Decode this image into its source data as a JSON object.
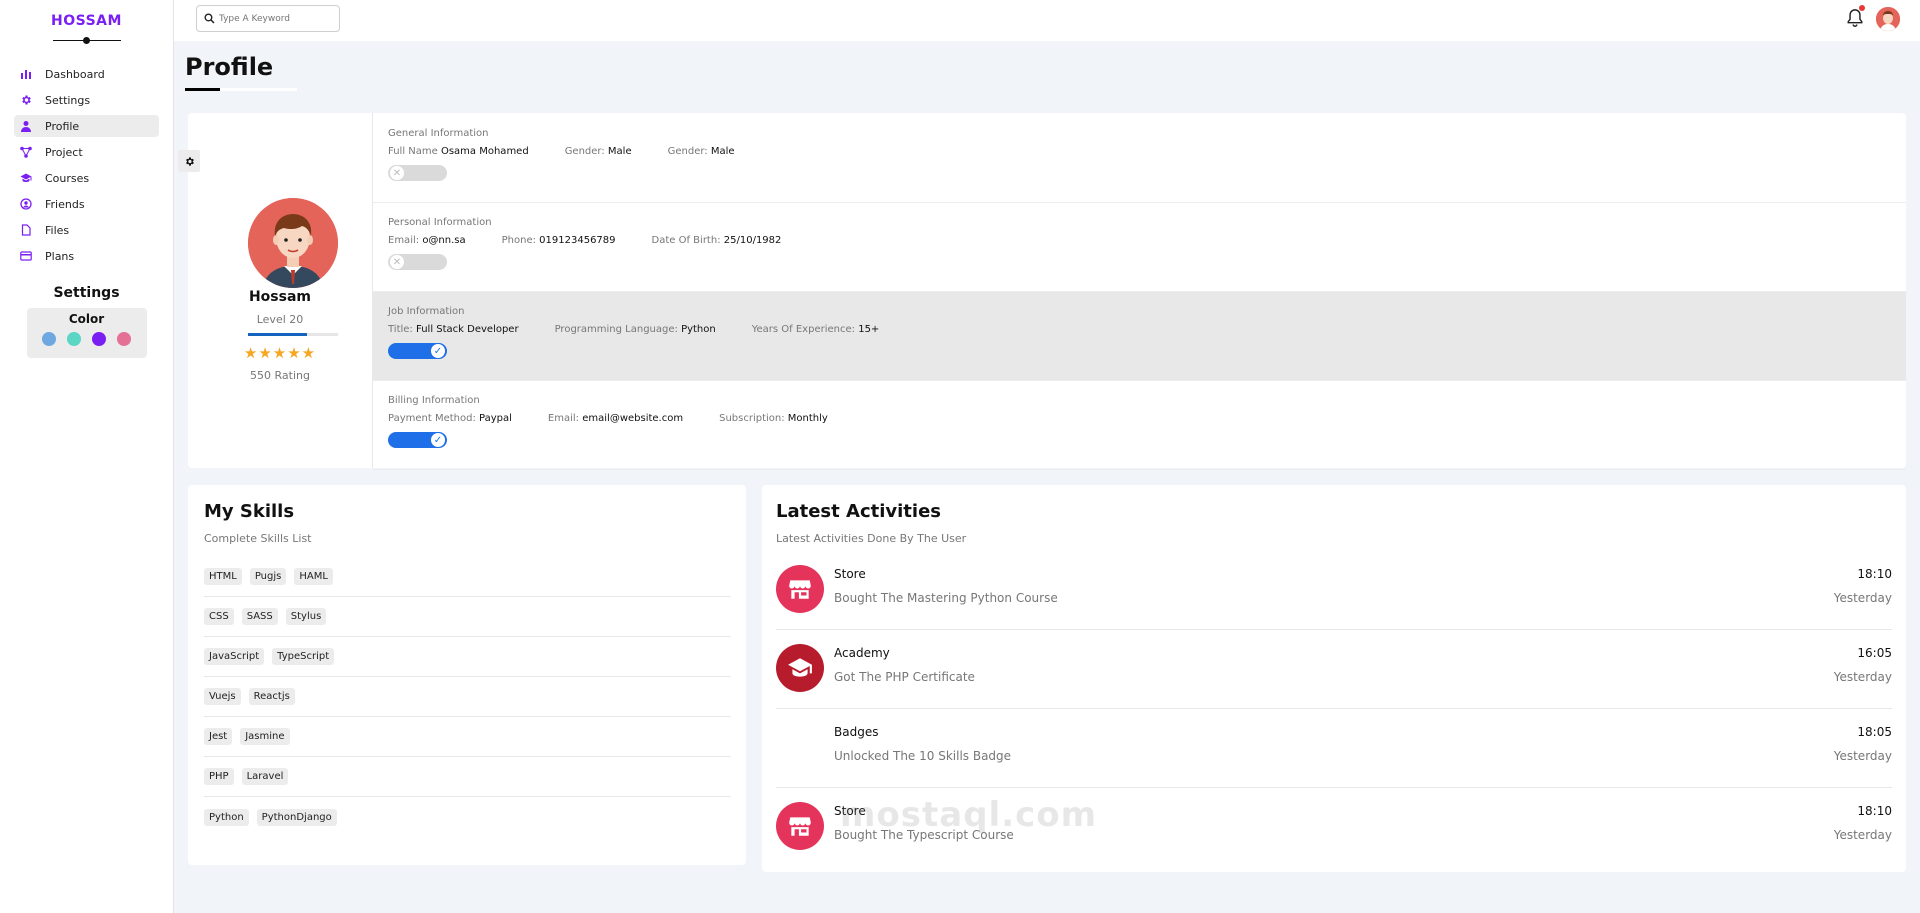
{
  "brand": "HOSSAM",
  "sidebar": {
    "items": [
      {
        "label": "Dashboard",
        "icon": "chart-bar-icon"
      },
      {
        "label": "Settings",
        "icon": "gear-icon"
      },
      {
        "label": "Profile",
        "icon": "user-icon"
      },
      {
        "label": "Project",
        "icon": "diagram-icon"
      },
      {
        "label": "Courses",
        "icon": "graduation-cap-icon"
      },
      {
        "label": "Friends",
        "icon": "user-circle-icon"
      },
      {
        "label": "Files",
        "icon": "file-icon"
      },
      {
        "label": "Plans",
        "icon": "credit-card-icon"
      }
    ],
    "active": "Profile",
    "settings_title": "Settings",
    "color_label": "Color",
    "swatches": [
      "#6fa8e0",
      "#5bd6c4",
      "#7a1ff2",
      "#e57096"
    ]
  },
  "header": {
    "search_placeholder": "Type A Keyword"
  },
  "page": {
    "title": "Profile"
  },
  "profile": {
    "name": "Hossam",
    "level": "Level 20",
    "level_progress": 0.65,
    "stars": 5,
    "rating": "550 Rating",
    "sections": [
      {
        "title": "General Information",
        "fields": [
          {
            "key": "Full Name",
            "value": "Osama Mohamed"
          },
          {
            "key": "Gender:",
            "value": "Male"
          },
          {
            "key": "Gender:",
            "value": "Male"
          }
        ],
        "enabled": false,
        "highlighted": false
      },
      {
        "title": "Personal Information",
        "fields": [
          {
            "key": "Email:",
            "value": "o@nn.sa"
          },
          {
            "key": "Phone:",
            "value": "019123456789"
          },
          {
            "key": "Date Of Birth:",
            "value": "25/10/1982"
          }
        ],
        "enabled": false,
        "highlighted": false
      },
      {
        "title": "Job Information",
        "fields": [
          {
            "key": "Title:",
            "value": "Full Stack Developer"
          },
          {
            "key": "Programming Language:",
            "value": "Python"
          },
          {
            "key": "Years Of Experience:",
            "value": "15+"
          }
        ],
        "enabled": true,
        "highlighted": true
      },
      {
        "title": "Billing Information",
        "fields": [
          {
            "key": "Payment Method:",
            "value": "Paypal"
          },
          {
            "key": "Email:",
            "value": "email@website.com"
          },
          {
            "key": "Subscription:",
            "value": "Monthly"
          }
        ],
        "enabled": true,
        "highlighted": false
      }
    ]
  },
  "skills": {
    "title": "My Skills",
    "subtitle": "Complete Skills List",
    "rows": [
      [
        "HTML",
        "Pugjs",
        "HAML"
      ],
      [
        "CSS",
        "SASS",
        "Stylus"
      ],
      [
        "JavaScript",
        "TypeScript"
      ],
      [
        "Vuejs",
        "Reactjs"
      ],
      [
        "Jest",
        "Jasmine"
      ],
      [
        "PHP",
        "Laravel"
      ],
      [
        "Python",
        "PythonDjango"
      ]
    ]
  },
  "activities": {
    "title": "Latest Activities",
    "subtitle": "Latest Activities Done By The User",
    "items": [
      {
        "name": "Store",
        "desc": "Bought The Mastering Python Course",
        "time": "18:10",
        "day": "Yesterday",
        "icon": "store-icon",
        "color": "#e5345b"
      },
      {
        "name": "Academy",
        "desc": "Got The PHP Certificate",
        "time": "16:05",
        "day": "Yesterday",
        "icon": "graduation-cap-icon",
        "color": "#b71c2c"
      },
      {
        "name": "Badges",
        "desc": "Unlocked The 10 Skills Badge",
        "time": "18:05",
        "day": "Yesterday",
        "icon": "",
        "color": ""
      },
      {
        "name": "Store",
        "desc": "Bought The Typescript Course",
        "time": "18:10",
        "day": "Yesterday",
        "icon": "store-icon",
        "color": "#e5345b"
      }
    ]
  },
  "watermark": "mostaql.com"
}
